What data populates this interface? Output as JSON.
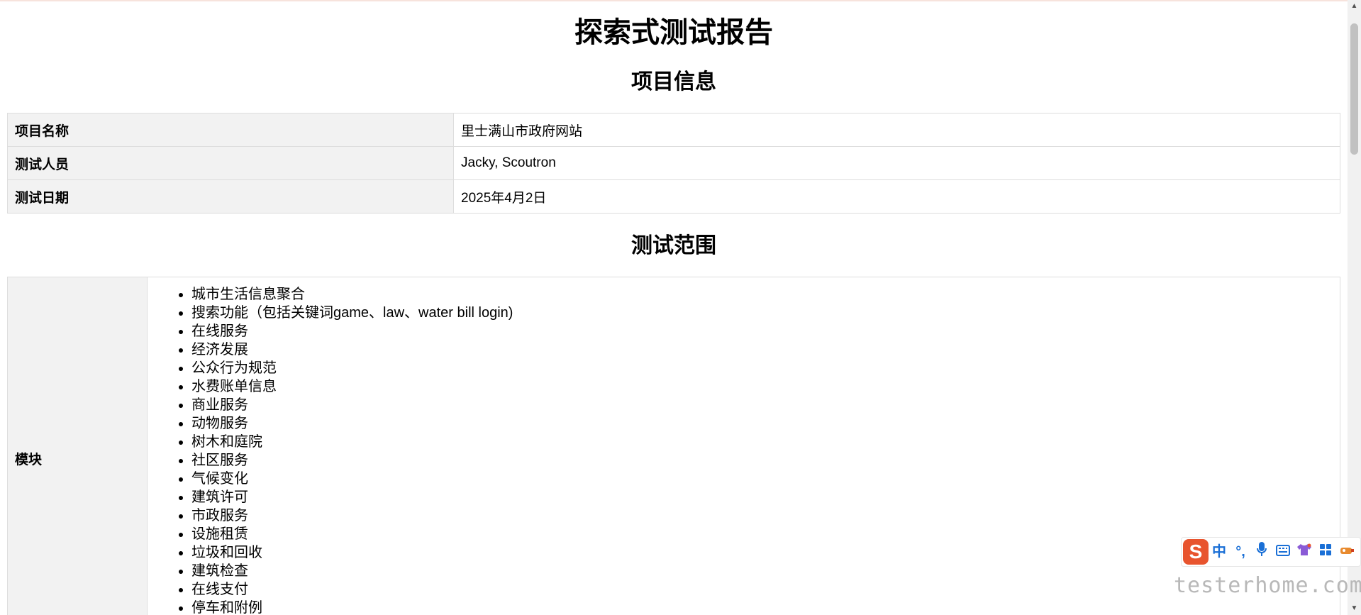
{
  "report": {
    "title": "探索式测试报告"
  },
  "project_section": {
    "heading": "项目信息",
    "rows": [
      {
        "label": "项目名称",
        "value": "里士满山市政府网站"
      },
      {
        "label": "测试人员",
        "value": "Jacky, Scoutron"
      },
      {
        "label": "测试日期",
        "value": "2025年4月2日"
      }
    ]
  },
  "scope_section": {
    "heading": "测试范围",
    "module_label": "模块",
    "modules": [
      "城市生活信息聚合",
      "搜索功能（包括关键词game、law、water bill login)",
      "在线服务",
      "经济发展",
      "公众行为规范",
      "水费账单信息",
      "商业服务",
      "动物服务",
      "树木和庭院",
      "社区服务",
      "气候变化",
      "建筑许可",
      "市政服务",
      "设施租赁",
      "垃圾和回收",
      "建筑检查",
      "在线支付",
      "停车和附例"
    ]
  },
  "ime_toolbar": {
    "logo": "S",
    "mode": "中",
    "punct": "°,",
    "icons": [
      "mic-icon",
      "keyboard-icon",
      "shirt-icon",
      "grid-icon",
      "tools-icon"
    ]
  },
  "watermark": "testerhome.com"
}
